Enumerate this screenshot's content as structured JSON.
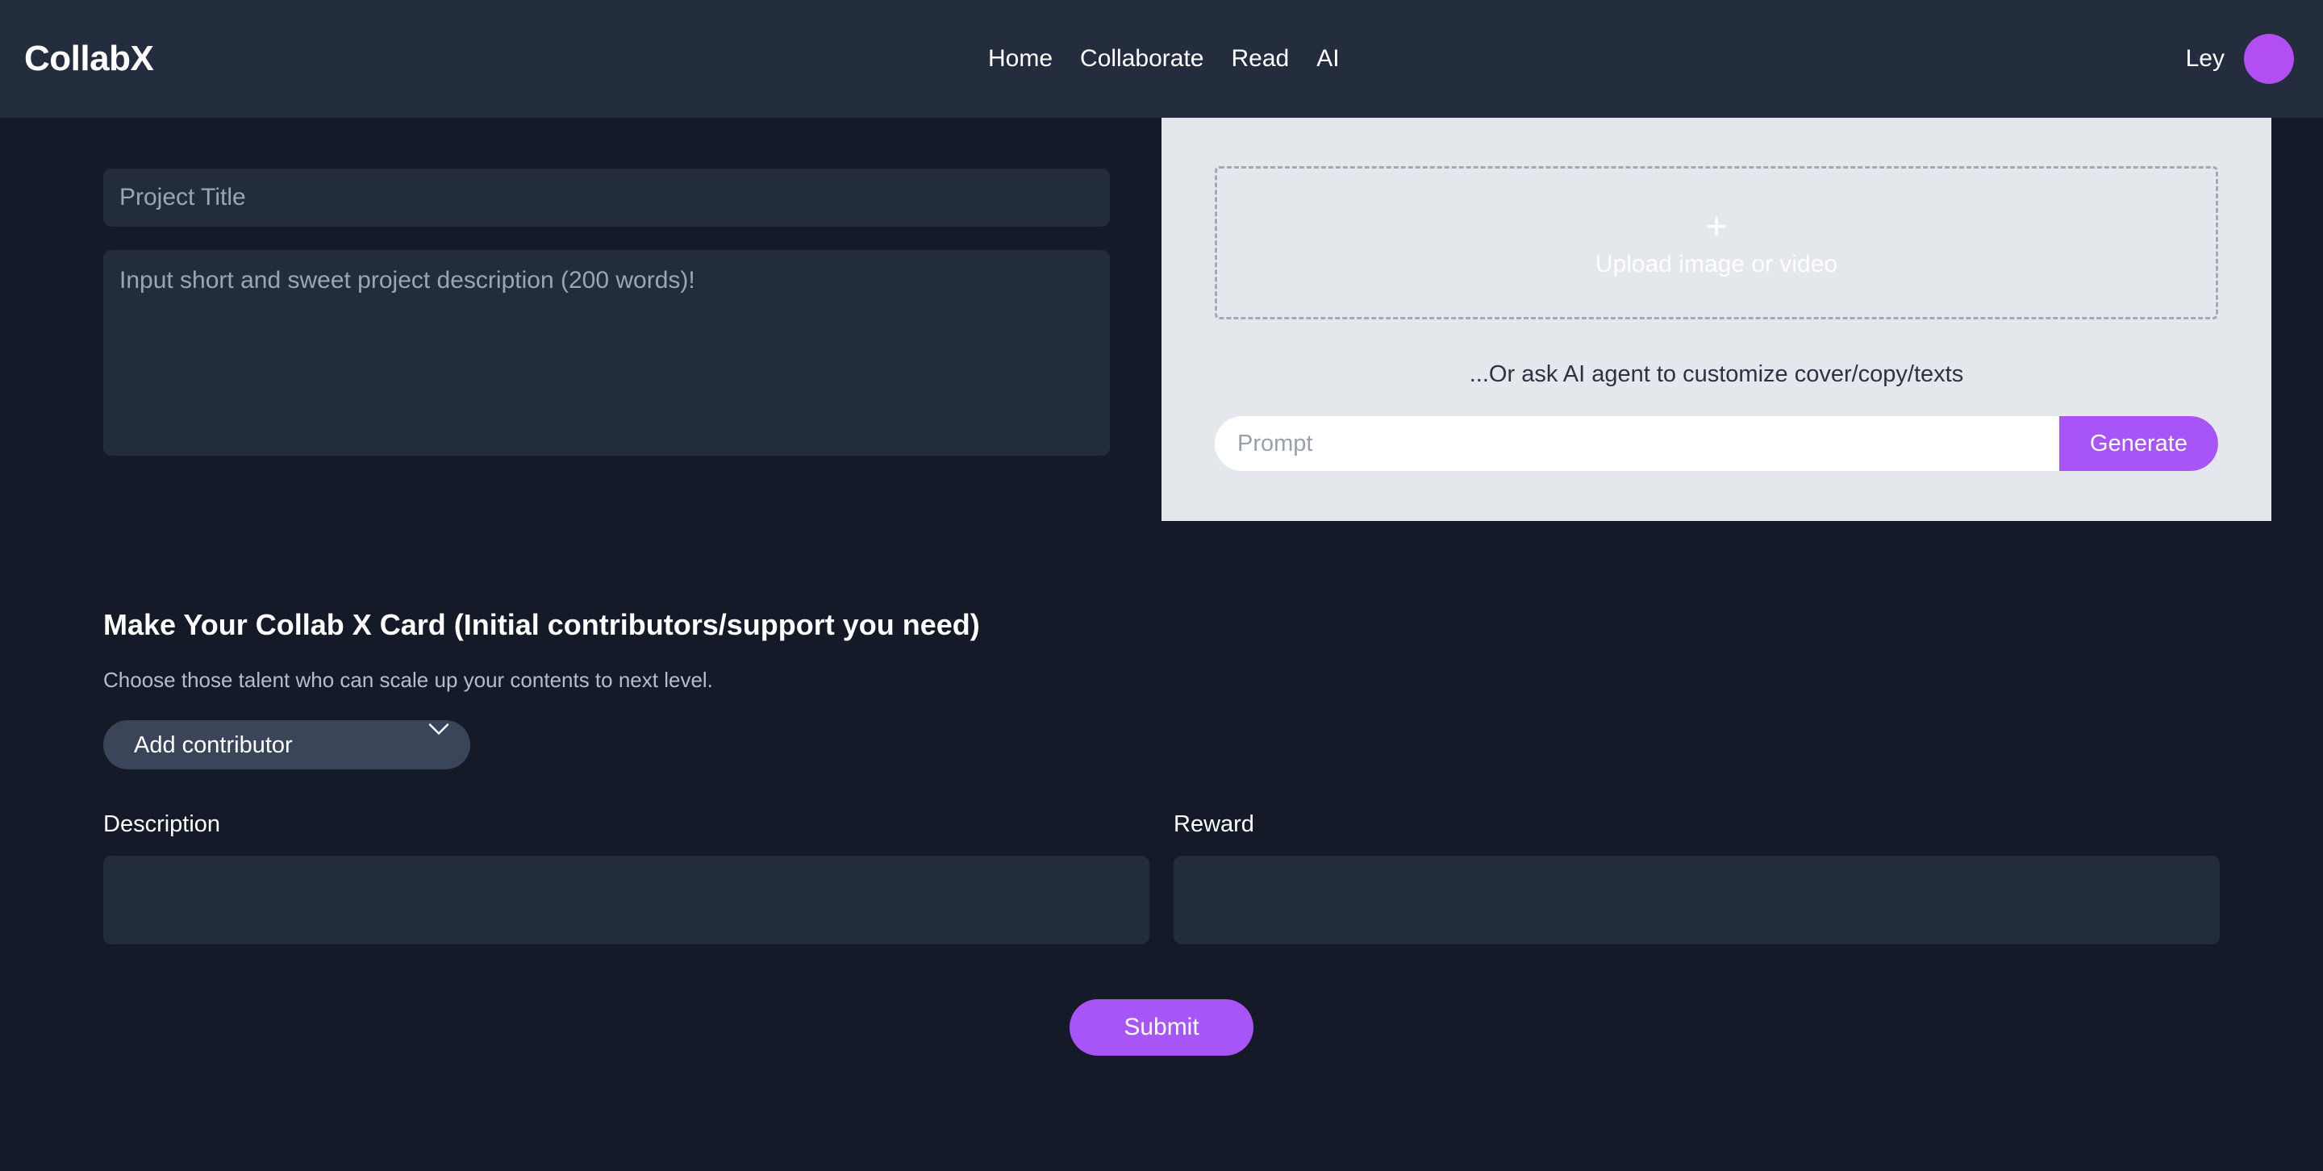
{
  "header": {
    "brand": "CollabX",
    "nav": [
      {
        "label": "Home"
      },
      {
        "label": "Collaborate"
      },
      {
        "label": "Read"
      },
      {
        "label": "AI"
      }
    ],
    "user": {
      "name": "Ley",
      "avatar_icon": "avatar-circle",
      "avatar_color": "#b24ef2"
    }
  },
  "project_form": {
    "title_value": "",
    "title_placeholder": "Project Title",
    "description_value": "",
    "description_placeholder": "Input short and sweet project description (200 words)!"
  },
  "upload_panel": {
    "dropzone": {
      "plus_icon": "plus-icon",
      "label": "Upload image or video"
    },
    "ai_hint": "...Or ask AI agent to customize cover/copy/texts",
    "prompt_value": "",
    "prompt_placeholder": "Prompt",
    "generate_label": "Generate",
    "panel_bg": "#e4e7ec",
    "accent": "#a855f7"
  },
  "card_section": {
    "title": "Make Your Collab X Card (Initial contributors/support you need)",
    "subtitle": "Choose those talent who can scale up your contents to next level.",
    "contributor_select": {
      "selected": "Add contributor",
      "options": [
        "Add contributor"
      ],
      "chevron_icon": "chevron-down-icon"
    },
    "description": {
      "label": "Description",
      "value": "",
      "placeholder": ""
    },
    "reward": {
      "label": "Reward",
      "value": "",
      "placeholder": ""
    },
    "submit_label": "Submit"
  }
}
